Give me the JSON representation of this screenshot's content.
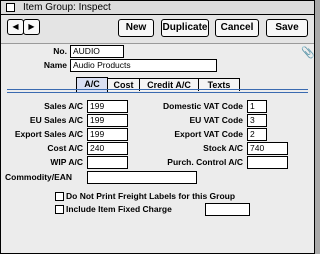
{
  "window": {
    "title": "Item Group: Inspect"
  },
  "toolbar": {
    "prev_glyph": "◀",
    "next_glyph": "▶",
    "new_label": "New",
    "duplicate_label": "Duplicate",
    "cancel_label": "Cancel",
    "save_label": "Save"
  },
  "header": {
    "no_label": "No.",
    "no_value": "AUDIO",
    "name_label": "Name",
    "name_value": "Audio Products",
    "attachment_glyph": "📎"
  },
  "tabs": [
    {
      "label": "A/C",
      "active": true
    },
    {
      "label": "Cost",
      "active": false
    },
    {
      "label": "Credit A/C",
      "active": false
    },
    {
      "label": "Texts",
      "active": false
    }
  ],
  "form": {
    "sales_ac_label": "Sales A/C",
    "sales_ac_value": "199",
    "eu_sales_ac_label": "EU Sales A/C",
    "eu_sales_ac_value": "199",
    "export_sales_ac_label": "Export Sales A/C",
    "export_sales_ac_value": "199",
    "cost_ac_label": "Cost A/C",
    "cost_ac_value": "240",
    "wip_ac_label": "WIP A/C",
    "wip_ac_value": "",
    "commodity_ean_label": "Commodity/EAN",
    "commodity_ean_value": "",
    "domestic_vat_label": "Domestic VAT Code",
    "domestic_vat_value": "1",
    "eu_vat_label": "EU VAT Code",
    "eu_vat_value": "3",
    "export_vat_label": "Export VAT Code",
    "export_vat_value": "2",
    "stock_ac_label": "Stock A/C",
    "stock_ac_value": "740",
    "purch_control_label": "Purch. Control A/C",
    "purch_control_value": "",
    "no_freight_label": "Do Not Print Freight Labels for this Group",
    "no_freight_checked": false,
    "fixed_charge_label": "Include Item Fixed Charge",
    "fixed_charge_checked": false,
    "fixed_charge_value": ""
  }
}
